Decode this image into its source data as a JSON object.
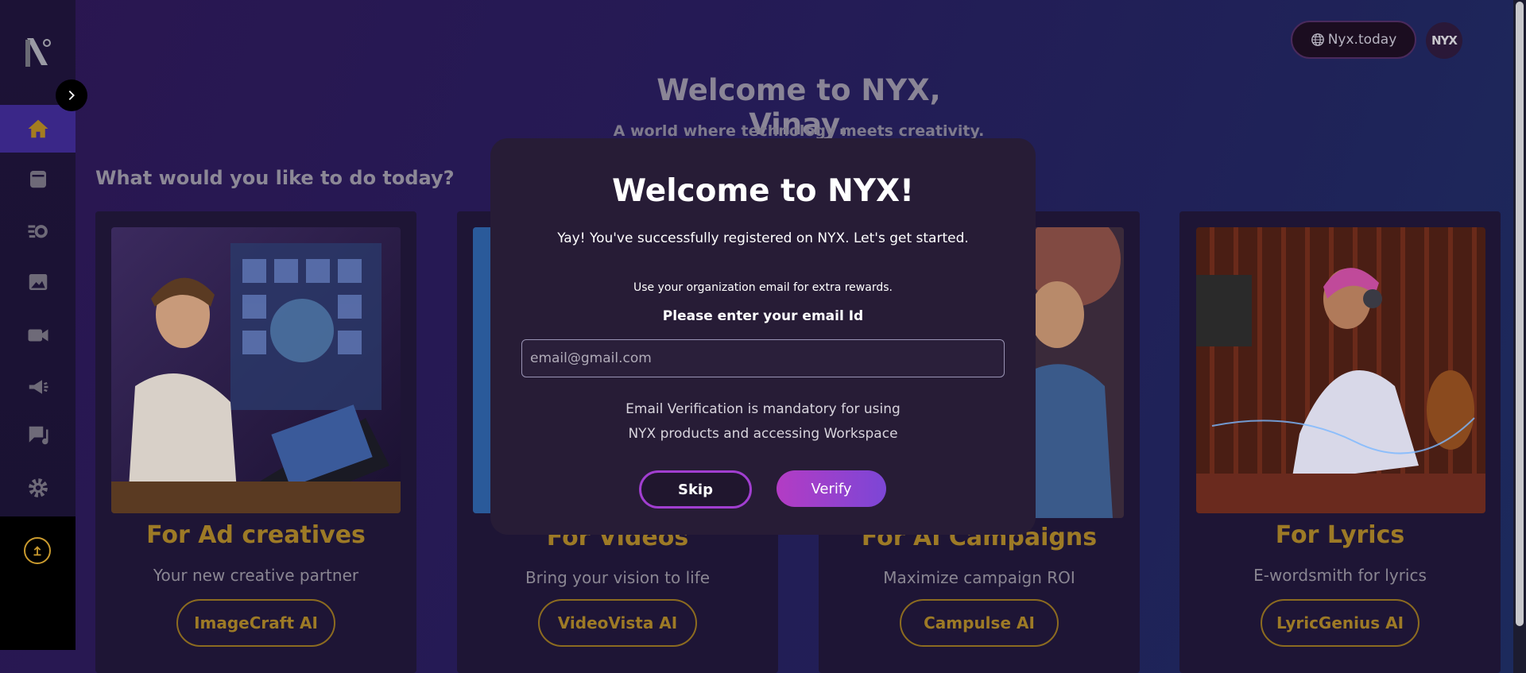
{
  "header": {
    "site_label": "Nyx.today",
    "avatar_text": "NYX",
    "hero_title": "Welcome to NYX, Vinay.",
    "hero_subtitle": "A world where technology meets creativity."
  },
  "section_question": "What would you like to do today?",
  "sidebar": {
    "items": [
      {
        "icon": "home-icon",
        "active": true
      },
      {
        "icon": "calendar-icon",
        "active": false
      },
      {
        "icon": "workflow-gear-icon",
        "active": false
      },
      {
        "icon": "image-icon",
        "active": false
      },
      {
        "icon": "video-camera-icon",
        "active": false
      },
      {
        "icon": "megaphone-icon",
        "active": false
      },
      {
        "icon": "lyrics-note-icon",
        "active": false
      },
      {
        "icon": "settings-gear-icon",
        "active": false
      }
    ],
    "upload_icon": "upload-arrow-icon"
  },
  "cards": [
    {
      "title": "For Ad creatives",
      "tagline": "Your new creative partner",
      "cta": "ImageCraft AI"
    },
    {
      "title": "For Videos",
      "tagline": "Bring your vision to life",
      "cta": "VideoVista AI"
    },
    {
      "title": "For AI Campaigns",
      "tagline": "Maximize campaign ROI",
      "cta": "Campulse AI"
    },
    {
      "title": "For Lyrics",
      "tagline": "E-wordsmith for lyrics",
      "cta": "LyricGenius AI"
    }
  ],
  "modal": {
    "title": "Welcome to NYX!",
    "message": "Yay! You've successfully registered on NYX. Let's get started.",
    "hint": "Use your organization email for extra rewards.",
    "label": "Please enter your email Id",
    "email_placeholder": "email@gmail.com",
    "email_value": "",
    "note_line1": "Email Verification is mandatory for using",
    "note_line2": "NYX products and accessing Workspace",
    "skip_label": "Skip",
    "verify_label": "Verify"
  },
  "colors": {
    "accent_gold": "#9d7a26",
    "accent_purple": "#a13ed0",
    "sidebar_active": "#3a2788"
  }
}
